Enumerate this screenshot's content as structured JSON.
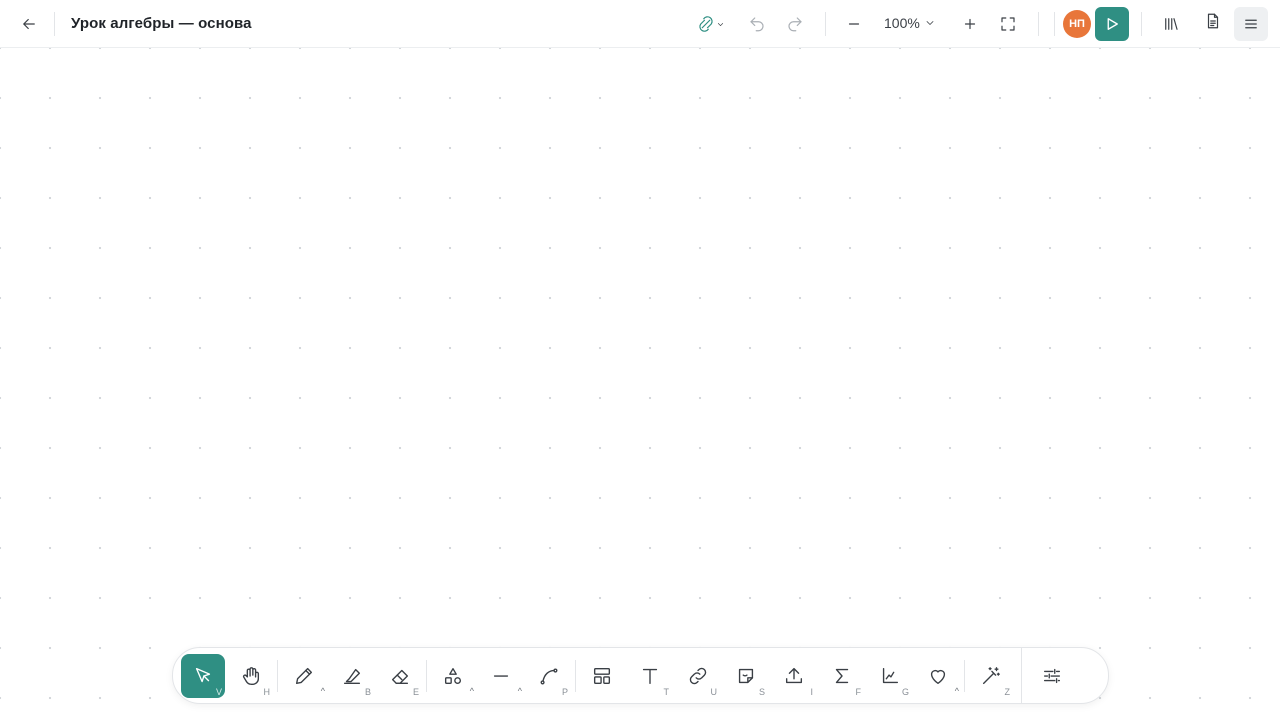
{
  "header": {
    "title": "Урок алгебры — основа",
    "zoom_label": "100%",
    "avatar_initials": "НП",
    "back_icon": "arrow-left-icon",
    "sync_icon": "cloud-sync-icon",
    "undo_icon": "undo-icon",
    "redo_icon": "redo-icon",
    "zoom_out_icon": "minus-icon",
    "zoom_in_icon": "plus-icon",
    "fullscreen_icon": "fullscreen-icon",
    "present_icon": "play-icon",
    "library_icon": "library-icon",
    "document_icon": "document-icon",
    "menu_icon": "hamburger-icon"
  },
  "toolbar": {
    "tools": [
      {
        "name": "select",
        "hotkey": "V"
      },
      {
        "name": "hand",
        "hotkey": "H"
      },
      {
        "name": "pencil",
        "hotkey": ""
      },
      {
        "name": "highlighter",
        "hotkey": "B"
      },
      {
        "name": "eraser",
        "hotkey": "E"
      },
      {
        "name": "shapes",
        "hotkey": ""
      },
      {
        "name": "line",
        "hotkey": ""
      },
      {
        "name": "curve",
        "hotkey": "P"
      },
      {
        "name": "layout",
        "hotkey": ""
      },
      {
        "name": "text",
        "hotkey": "T"
      },
      {
        "name": "link",
        "hotkey": "U"
      },
      {
        "name": "sticker",
        "hotkey": "S"
      },
      {
        "name": "upload",
        "hotkey": "I"
      },
      {
        "name": "formula",
        "hotkey": "F"
      },
      {
        "name": "graph",
        "hotkey": "G"
      },
      {
        "name": "favorites",
        "hotkey": ""
      },
      {
        "name": "magic",
        "hotkey": "Z"
      },
      {
        "name": "settings",
        "hotkey": ""
      }
    ]
  },
  "colors": {
    "accent": "#2f8f83",
    "avatar": "#e8763a"
  }
}
